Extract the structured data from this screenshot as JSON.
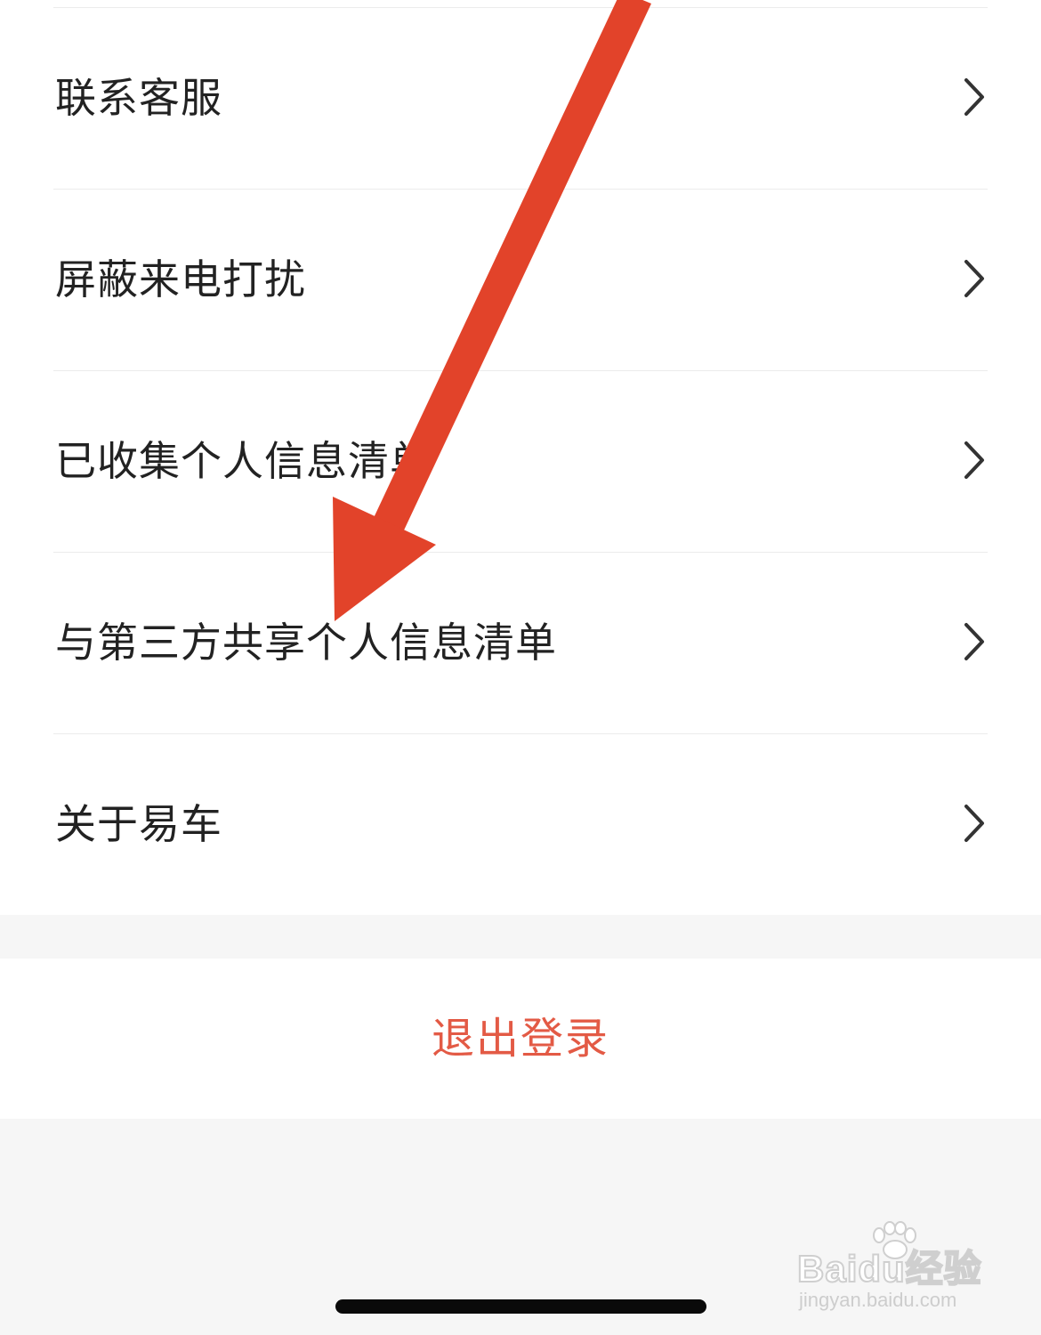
{
  "menu": {
    "items": [
      {
        "label": "联系客服"
      },
      {
        "label": "屏蔽来电打扰"
      },
      {
        "label": "已收集个人信息清单"
      },
      {
        "label": "与第三方共享个人信息清单"
      },
      {
        "label": "关于易车"
      }
    ]
  },
  "logout": {
    "label": "退出登录"
  },
  "watermark": {
    "logo": "Baidu经验",
    "url": "jingyan.baidu.com"
  },
  "colors": {
    "logout_text": "#e35a45",
    "annotation_arrow": "#e2432a",
    "page_background": "#f6f6f6"
  },
  "icons": {
    "row_chevron": "chevron-right-icon"
  }
}
